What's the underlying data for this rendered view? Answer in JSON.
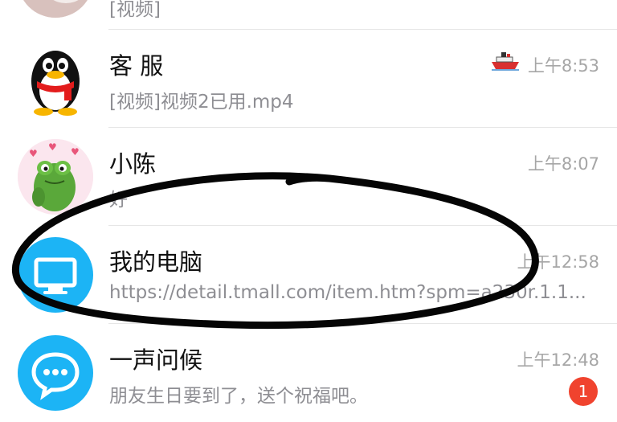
{
  "chats": [
    {
      "name": "",
      "preview": "[视频]",
      "time": "",
      "avatar_icon": "photo-avatar-icon"
    },
    {
      "name": "客 服",
      "preview": "[视频]视频2已用.mp4",
      "time": "上午8:53",
      "status_icon": "ship-icon",
      "avatar_icon": "penguin-icon"
    },
    {
      "name": "小陈",
      "preview": "好",
      "time": "上午8:07",
      "avatar_icon": "frog-avatar-icon"
    },
    {
      "name": "我的电脑",
      "preview": "https://detail.tmall.com/item.htm?spm=a230r.1.1...",
      "time": "上午12:58",
      "avatar_icon": "monitor-icon"
    },
    {
      "name": "一声问候",
      "preview": "朋友生日要到了，送个祝福吧。",
      "time": "上午12:48",
      "badge": "1",
      "avatar_icon": "chat-bubble-icon"
    }
  ],
  "colors": {
    "accent_blue": "#1cb4f5",
    "badge_red": "#f0432e",
    "annotation_ink": "#050505"
  }
}
